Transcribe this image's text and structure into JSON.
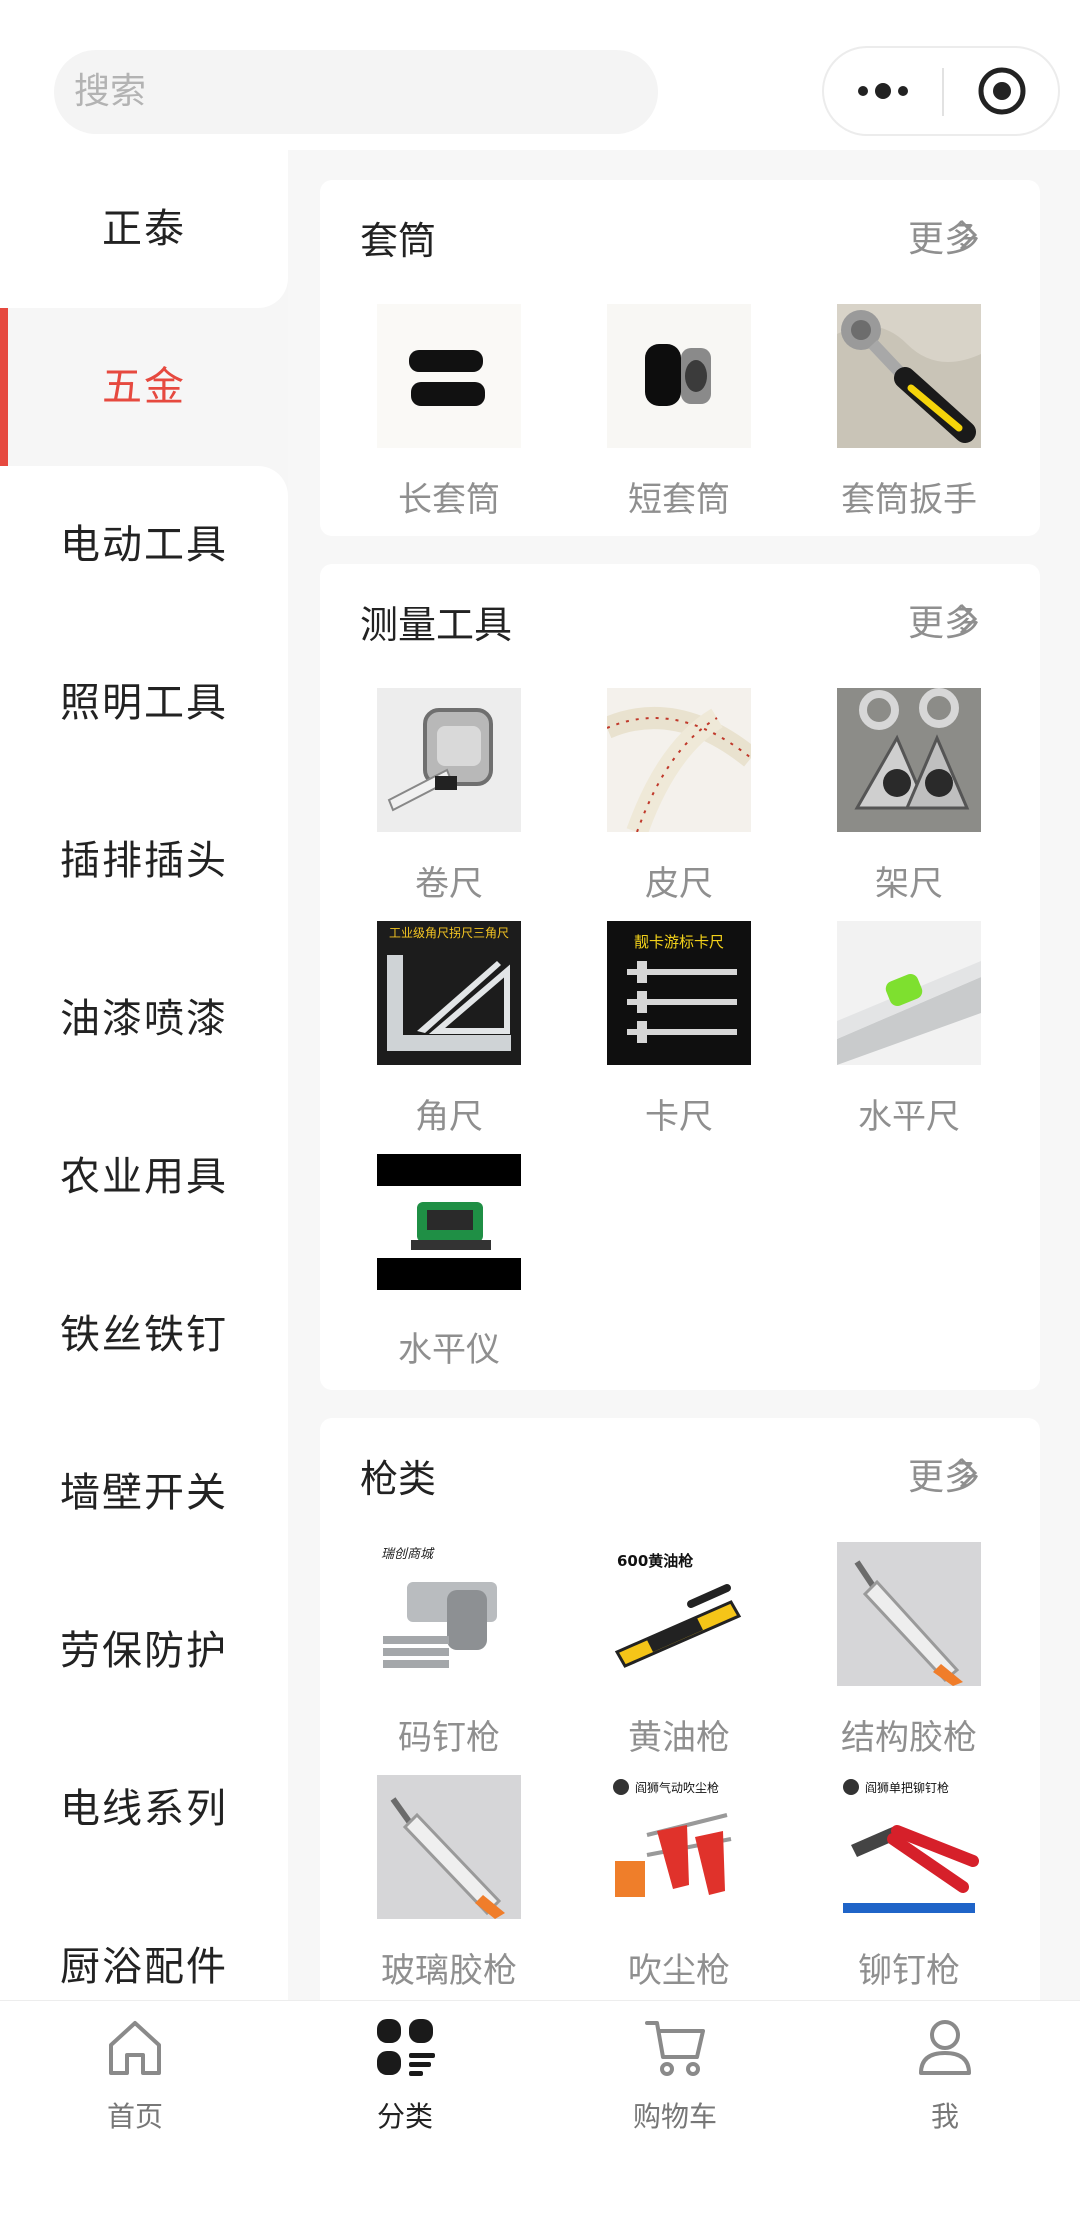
{
  "search": {
    "placeholder": "搜索"
  },
  "sidebar": {
    "items": [
      {
        "label": "正泰"
      },
      {
        "label": "五金",
        "active": true
      },
      {
        "label": "电动工具"
      },
      {
        "label": "照明工具"
      },
      {
        "label": "插排插头"
      },
      {
        "label": "油漆喷漆"
      },
      {
        "label": "农业用具"
      },
      {
        "label": "铁丝铁钉"
      },
      {
        "label": "墙壁开关"
      },
      {
        "label": "劳保防护"
      },
      {
        "label": "电线系列"
      },
      {
        "label": "厨浴配件"
      }
    ]
  },
  "sections": [
    {
      "title": "套筒",
      "more": "更多",
      "products": [
        {
          "label": "长套筒",
          "icon": "long-socket-image"
        },
        {
          "label": "短套筒",
          "icon": "short-socket-image"
        },
        {
          "label": "套筒扳手",
          "icon": "ratchet-wrench-image"
        }
      ]
    },
    {
      "title": "测量工具",
      "more": "更多",
      "products": [
        {
          "label": "卷尺",
          "icon": "tape-measure-image"
        },
        {
          "label": "皮尺",
          "icon": "cloth-tape-image"
        },
        {
          "label": "架尺",
          "icon": "frame-tape-image"
        },
        {
          "label": "角尺",
          "icon": "angle-ruler-image",
          "caption": "工业级角尺拐尺三角尺"
        },
        {
          "label": "卡尺",
          "icon": "caliper-image",
          "caption": "靓卡游标卡尺"
        },
        {
          "label": "水平尺",
          "icon": "spirit-level-image"
        },
        {
          "label": "水平仪",
          "icon": "laser-level-image"
        }
      ]
    },
    {
      "title": "枪类",
      "more": "更多",
      "products": [
        {
          "label": "码钉枪",
          "icon": "staple-gun-image",
          "caption": "瑞创商城"
        },
        {
          "label": "黄油枪",
          "icon": "grease-gun-image",
          "caption": "600黄油枪"
        },
        {
          "label": "结构胶枪",
          "icon": "structural-glue-gun-image"
        },
        {
          "label": "玻璃胶枪",
          "icon": "silicone-gun-image"
        },
        {
          "label": "吹尘枪",
          "icon": "air-blow-gun-image",
          "caption": "阎狮气动吹尘枪"
        },
        {
          "label": "铆钉枪",
          "icon": "rivet-gun-image",
          "caption": "阎狮单把铆钉枪"
        }
      ]
    }
  ],
  "tabbar": {
    "items": [
      {
        "label": "首页",
        "icon": "home-icon"
      },
      {
        "label": "分类",
        "icon": "category-icon",
        "active": true
      },
      {
        "label": "购物车",
        "icon": "cart-icon"
      },
      {
        "label": "我",
        "icon": "user-icon"
      }
    ]
  },
  "colors": {
    "accent": "#e6493f",
    "muted": "#8f8f8f",
    "background": "#f7f7f7"
  }
}
